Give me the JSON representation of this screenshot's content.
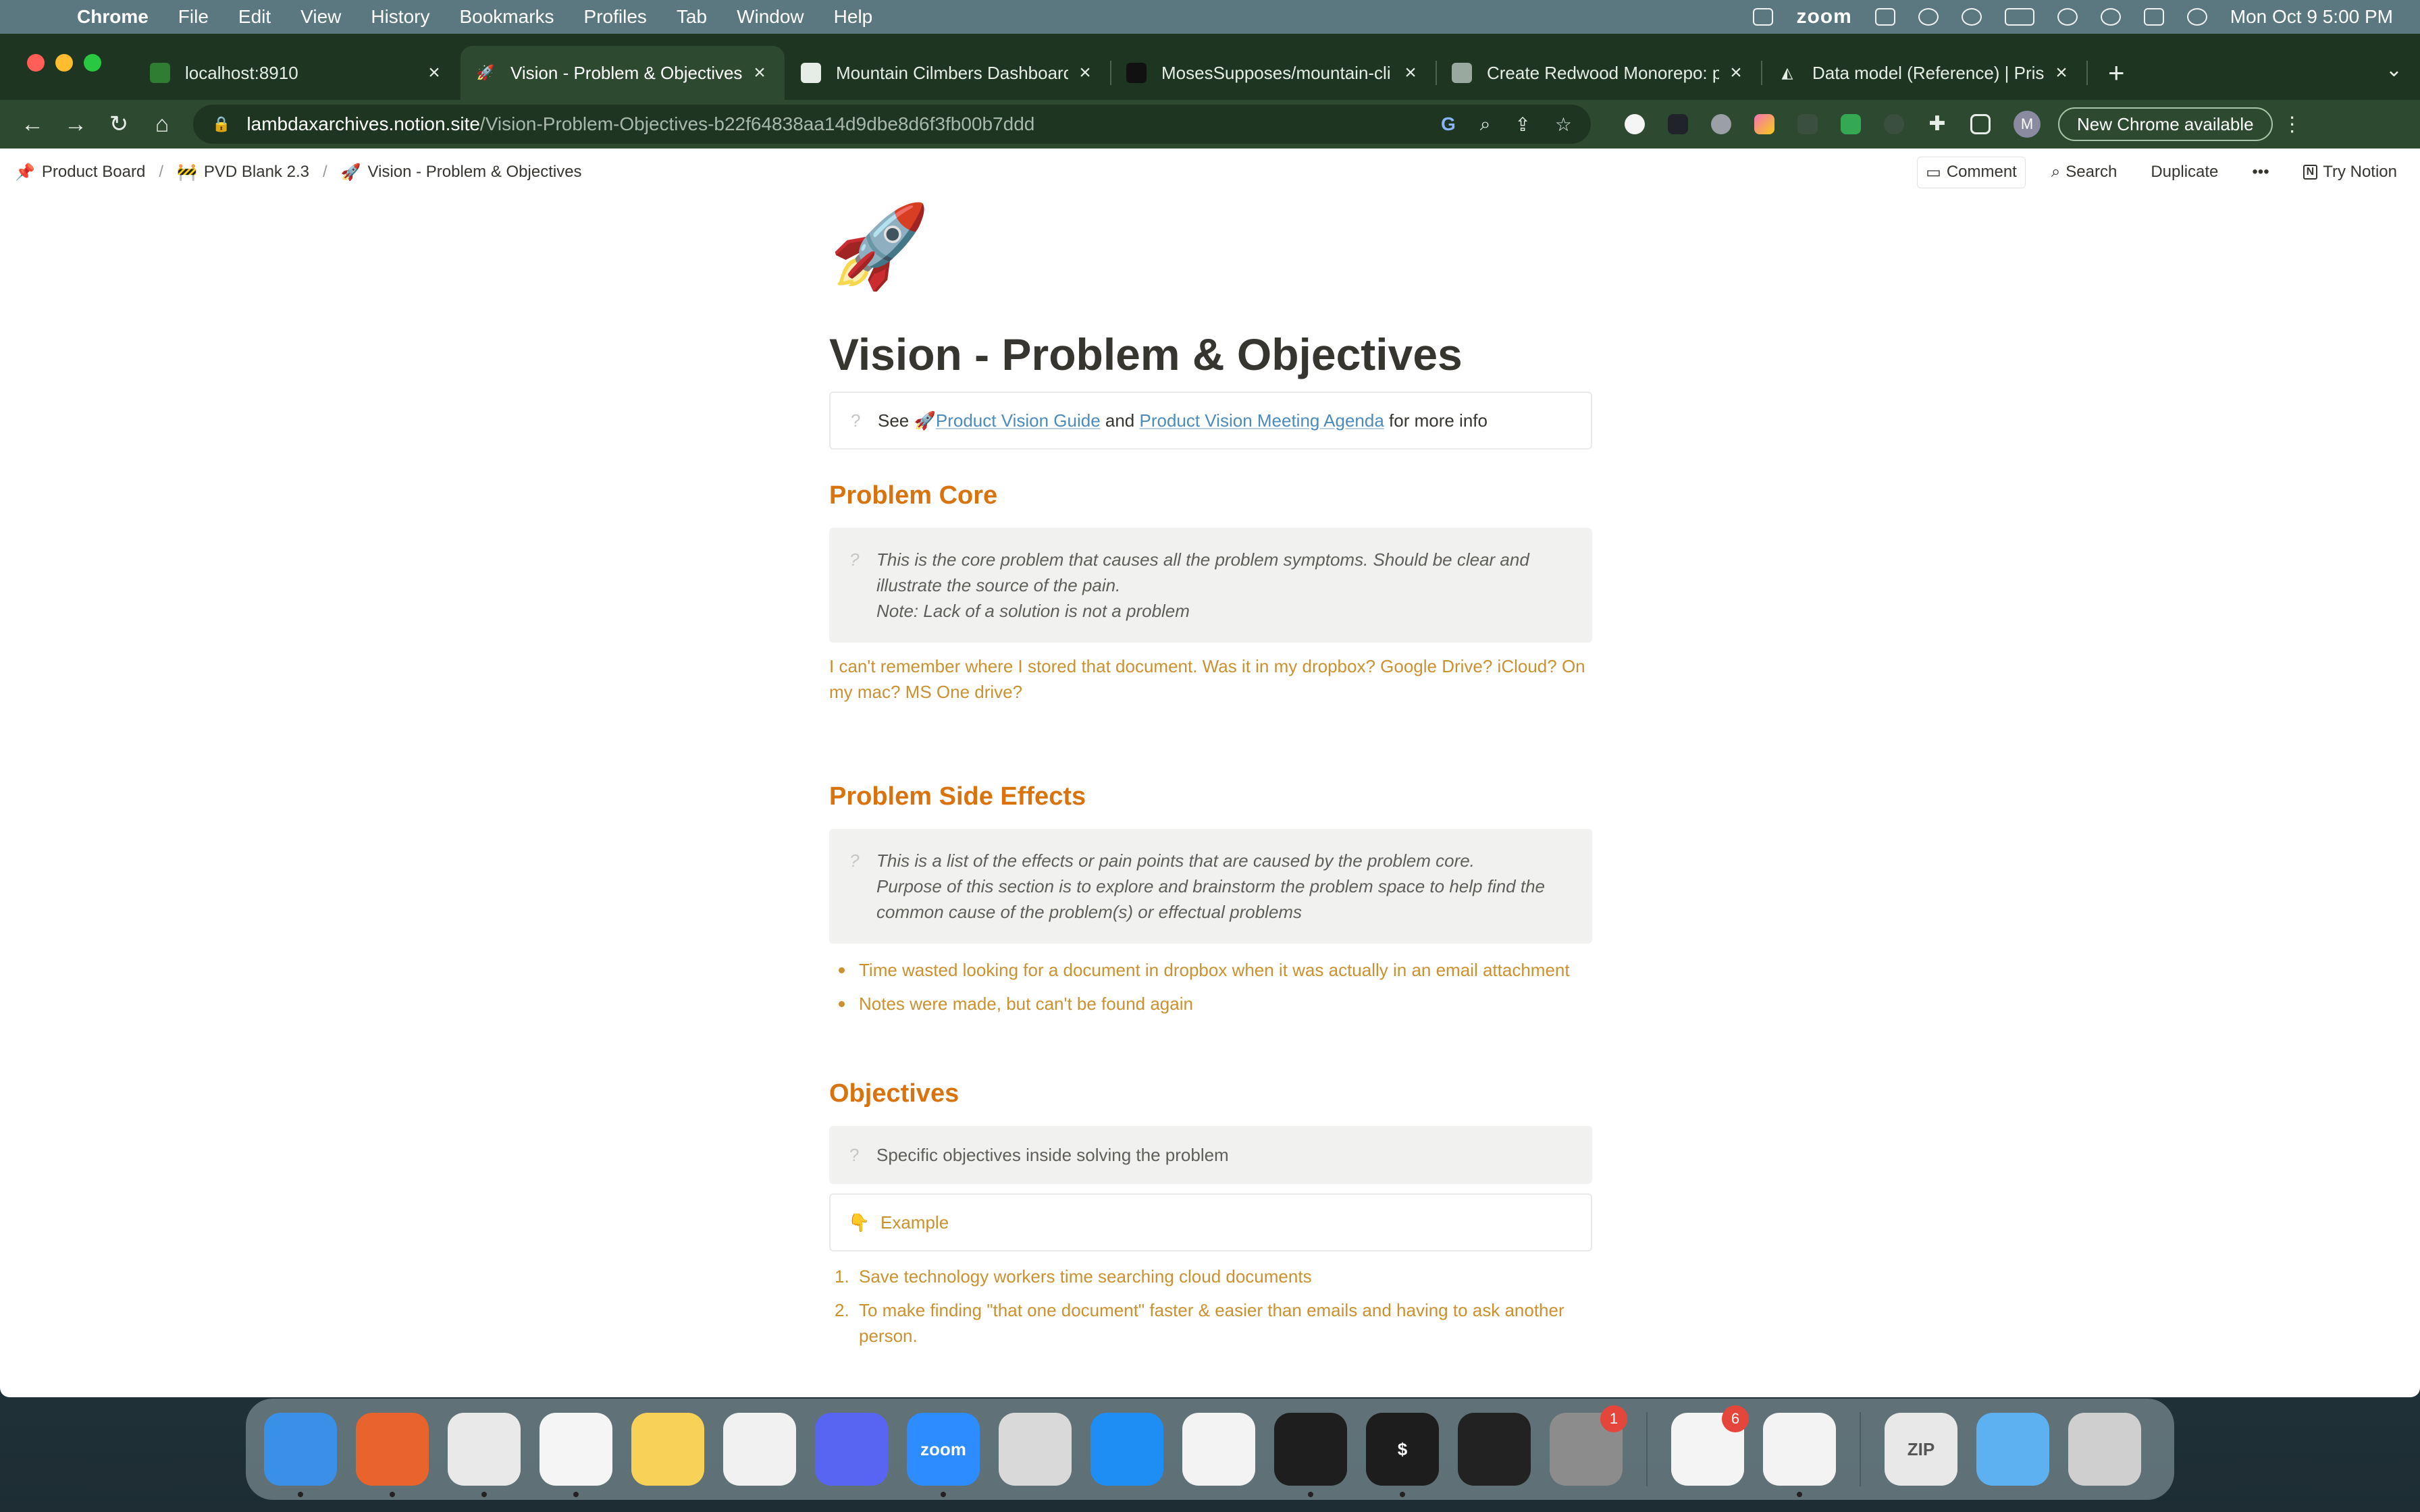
{
  "menubar": {
    "app": "Chrome",
    "items": [
      "File",
      "Edit",
      "View",
      "History",
      "Bookmarks",
      "Profiles",
      "Tab",
      "Window",
      "Help"
    ],
    "zoom": "zoom",
    "clock": "Mon Oct 9  5:00 PM"
  },
  "tabs": [
    {
      "title": "localhost:8910",
      "icon": "redwood-icon",
      "active": false
    },
    {
      "title": "Vision - Problem & Objectives",
      "icon": "rocket-icon",
      "active": true
    },
    {
      "title": "Mountain Cilmbers Dashboard",
      "icon": "trello-icon",
      "active": false
    },
    {
      "title": "MosesSupposes/mountain-cli",
      "icon": "github-icon",
      "active": false
    },
    {
      "title": "Create Redwood Monorepo: p",
      "icon": "chatgpt-icon",
      "active": false
    },
    {
      "title": "Data model (Reference) | Prism",
      "icon": "prisma-icon",
      "active": false
    }
  ],
  "address": {
    "host": "lambdaxarchives.notion.site",
    "path": "/Vision-Problem-Objectives-b22f64838aa14d9dbe8d6f3fb00b7ddd"
  },
  "toolbar": {
    "avatar": "M",
    "update_label": "New Chrome available"
  },
  "notion": {
    "breadcrumbs": [
      {
        "emoji": "📌",
        "label": "Product Board"
      },
      {
        "emoji": "🚧",
        "label": "PVD Blank 2.3"
      },
      {
        "emoji": "🚀",
        "label": "Vision - Problem & Objectives"
      }
    ],
    "actions": {
      "comment": "Comment",
      "search": "Search",
      "duplicate": "Duplicate",
      "more": "•••",
      "try": "Try Notion"
    }
  },
  "page": {
    "icon": "🚀",
    "title": "Vision - Problem & Objectives",
    "intro": {
      "see": "See ",
      "emoji": "🚀",
      "link1": "Product Vision Guide",
      "and": " and ",
      "link2": "Product Vision Meeting Agenda",
      "tail": " for more info"
    },
    "problem_core": {
      "heading": "Problem Core",
      "callout_lines": [
        "This is the core problem that causes all the problem symptoms. Should be clear and illustrate the source of the pain.",
        "Note: Lack of a solution is not a problem"
      ],
      "text": "I can't remember where I stored that document. Was it in my dropbox? Google Drive? iCloud? On my mac? MS One drive?"
    },
    "side_effects": {
      "heading": "Problem Side Effects",
      "callout_lines": [
        "This is a list of the effects or pain points that are caused by the problem core.",
        "Purpose of this section is to explore and brainstorm the problem space to help find the common cause of the problem(s) or effectual problems"
      ],
      "bullets": [
        "Time wasted looking for a document in dropbox when it was actually in an email attachment",
        "Notes were made, but can't be found again"
      ]
    },
    "objectives": {
      "heading": "Objectives",
      "callout": "Specific objectives inside solving the problem",
      "example_emoji": "👇",
      "example": "Example",
      "items": [
        "Save technology workers time searching cloud documents",
        "To make finding \"that one document\" faster & easier than emails and having to ask another person."
      ]
    }
  },
  "dock": {
    "apps": [
      {
        "name": "finder",
        "label": "",
        "color": "#3a8fe6",
        "running": true
      },
      {
        "name": "firefox",
        "label": "",
        "color": "#e8642c",
        "running": true
      },
      {
        "name": "chrome",
        "label": "",
        "color": "#e9e9e9",
        "running": true
      },
      {
        "name": "brave",
        "label": "",
        "color": "#f5f5f5",
        "running": true
      },
      {
        "name": "notes",
        "label": "",
        "color": "#f7d257",
        "running": false
      },
      {
        "name": "keynote",
        "label": "",
        "color": "#f1f1f1",
        "running": false
      },
      {
        "name": "discord",
        "label": "",
        "color": "#5865f2",
        "running": false
      },
      {
        "name": "zoom",
        "label": "zoom",
        "color": "#2d8cff",
        "running": true
      },
      {
        "name": "launchpad",
        "label": "",
        "color": "#d9d9d9",
        "running": false
      },
      {
        "name": "app-store",
        "label": "",
        "color": "#1e8ef5",
        "running": false
      },
      {
        "name": "vscode",
        "label": "",
        "color": "#f3f3f3",
        "running": false
      },
      {
        "name": "figma",
        "label": "",
        "color": "#1e1e1e",
        "running": true
      },
      {
        "name": "terminal",
        "label": "$",
        "color": "#1d1d1d",
        "running": true
      },
      {
        "name": "activity-monitor",
        "label": "",
        "color": "#222",
        "running": false
      },
      {
        "name": "system-settings",
        "label": "",
        "color": "#8c8c8c",
        "running": false,
        "badge": "1"
      },
      {
        "sep": true
      },
      {
        "name": "reminders",
        "label": "",
        "color": "#f4f4f4",
        "running": false,
        "badge": "6"
      },
      {
        "name": "vscode-2",
        "label": "",
        "color": "#f3f3f3",
        "running": true
      },
      {
        "sep": true
      },
      {
        "name": "zip-archive",
        "label": "ZIP",
        "color": "#e8e8e8",
        "running": false
      },
      {
        "name": "folder",
        "label": "",
        "color": "#5eb1f0",
        "running": false
      },
      {
        "name": "trash",
        "label": "",
        "color": "#cfcfcf",
        "running": false
      }
    ]
  },
  "colors": {
    "tab_strip": "#1e3522",
    "toolbar": "#2d4a31",
    "heading_orange": "#d9730d",
    "text_orange": "#cb912f",
    "link": "#4b8bbe"
  }
}
